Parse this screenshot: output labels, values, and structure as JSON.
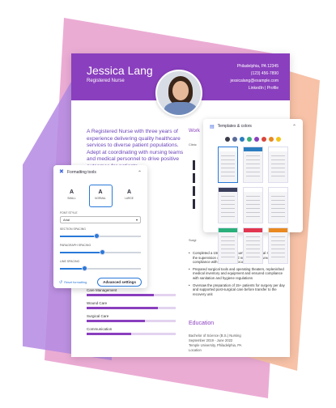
{
  "resume": {
    "name": "Jessica Lang",
    "role": "Registered Nurse",
    "contact": [
      "Philadelphia, PA 12345",
      "(123) 456-7890",
      "jessicalang@example.com",
      "LinkedIn | Profile"
    ],
    "summary": "A Registered Nurse with three years of experience delivering quality healthcare services to diverse patient populations. Adept at coordinating with nursing teams and medical personnel to drive positive outcomes for patients.",
    "work_heading": "Work",
    "work_title": "Clinic",
    "experience2": "Surgi",
    "experience2_bullets": [
      "Completed a 150-hour practicum in the surgical ICU under the supervision of a registered nurse and ensured compliance with hospital protocols",
      "Prepared surgical tools and operating theaters, replenished medical inventory and equipment and ensured compliance with sanitation and hygiene regulations",
      "Oversaw the preparation of 15+ patients for surgery per day and supported post-surgical care before transfer to the recovery unit"
    ],
    "education_heading": "Education",
    "education_lines": [
      "Bachelor of Science (B.S.) Nursing",
      "September 2019 - June 2022",
      "Temple University, Philadelphia, PA",
      "Location"
    ],
    "skills": [
      {
        "label": "Care Management",
        "level": 0.75
      },
      {
        "label": "Wound Care",
        "level": 0.8
      },
      {
        "label": "Surgical Care",
        "level": 0.65
      },
      {
        "label": "Communication",
        "level": 0.5
      }
    ],
    "accent": "#8a3fbe"
  },
  "formatting": {
    "title": "Formatting tools",
    "sizes": [
      {
        "label": "SMALL",
        "active": false
      },
      {
        "label": "NORMAL",
        "active": true
      },
      {
        "label": "LARGE",
        "active": false
      }
    ],
    "font_style_label": "FONT STYLE",
    "font_value": "Arial",
    "sliders": [
      {
        "label": "SECTION SPACING",
        "value": 0.45
      },
      {
        "label": "PARAGRAPH SPACING",
        "value": 0.52
      },
      {
        "label": "LINE SPACING",
        "value": 0.3
      }
    ],
    "reset_label": "Reset formatting",
    "advanced_label": "Advanced settings",
    "accent": "#2979d9"
  },
  "templates": {
    "title": "Templates & colors",
    "swatches": [
      "#3a3a4a",
      "#5b6b9a",
      "#2b7dbf",
      "#3bb07a",
      "#8a3fbe",
      "#d9463b",
      "#e9891f",
      "#f3c519"
    ],
    "thumb_bars": [
      "#ffffff",
      "#2b7dbf",
      "#ffffff",
      "#3b3f5c",
      "#ffffff",
      "#ffffff",
      "#2ab07a",
      "#e2354f",
      "#e9891f"
    ]
  }
}
